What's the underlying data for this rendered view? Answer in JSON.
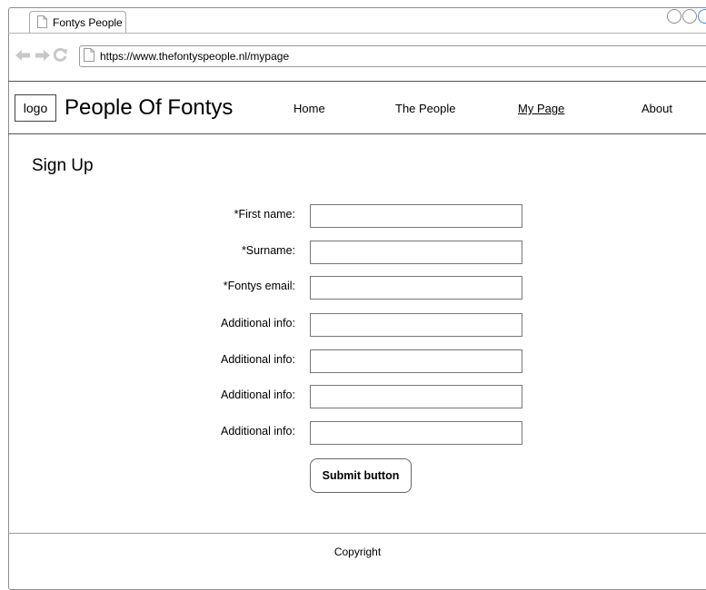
{
  "browser": {
    "tab_title": "Fontys People",
    "url": "https://www.thefontyspeople.nl/mypage"
  },
  "header": {
    "logo": "logo",
    "site_title": "People Of Fontys",
    "nav": [
      {
        "label": "Home",
        "active": false
      },
      {
        "label": "The People",
        "active": false
      },
      {
        "label": "My Page",
        "active": true
      },
      {
        "label": "About",
        "active": false
      }
    ]
  },
  "page": {
    "title": "Sign Up"
  },
  "form": {
    "fields": [
      {
        "label": "*First name:",
        "value": ""
      },
      {
        "label": "*Surname:",
        "value": ""
      },
      {
        "label": "*Fontys email:",
        "value": ""
      },
      {
        "label": "Additional info:",
        "value": ""
      },
      {
        "label": "Additional info:",
        "value": ""
      },
      {
        "label": "Additional info:",
        "value": ""
      },
      {
        "label": "Additional info:",
        "value": ""
      }
    ],
    "submit_label": "Submit button"
  },
  "footer": {
    "text": "Copyright"
  },
  "icons": [
    "page-icon",
    "back-arrow-icon",
    "forward-arrow-icon",
    "reload-icon",
    "window-control-icon"
  ],
  "colors": {
    "border": "#555555",
    "chrome_gray": "#b5b5b5"
  }
}
